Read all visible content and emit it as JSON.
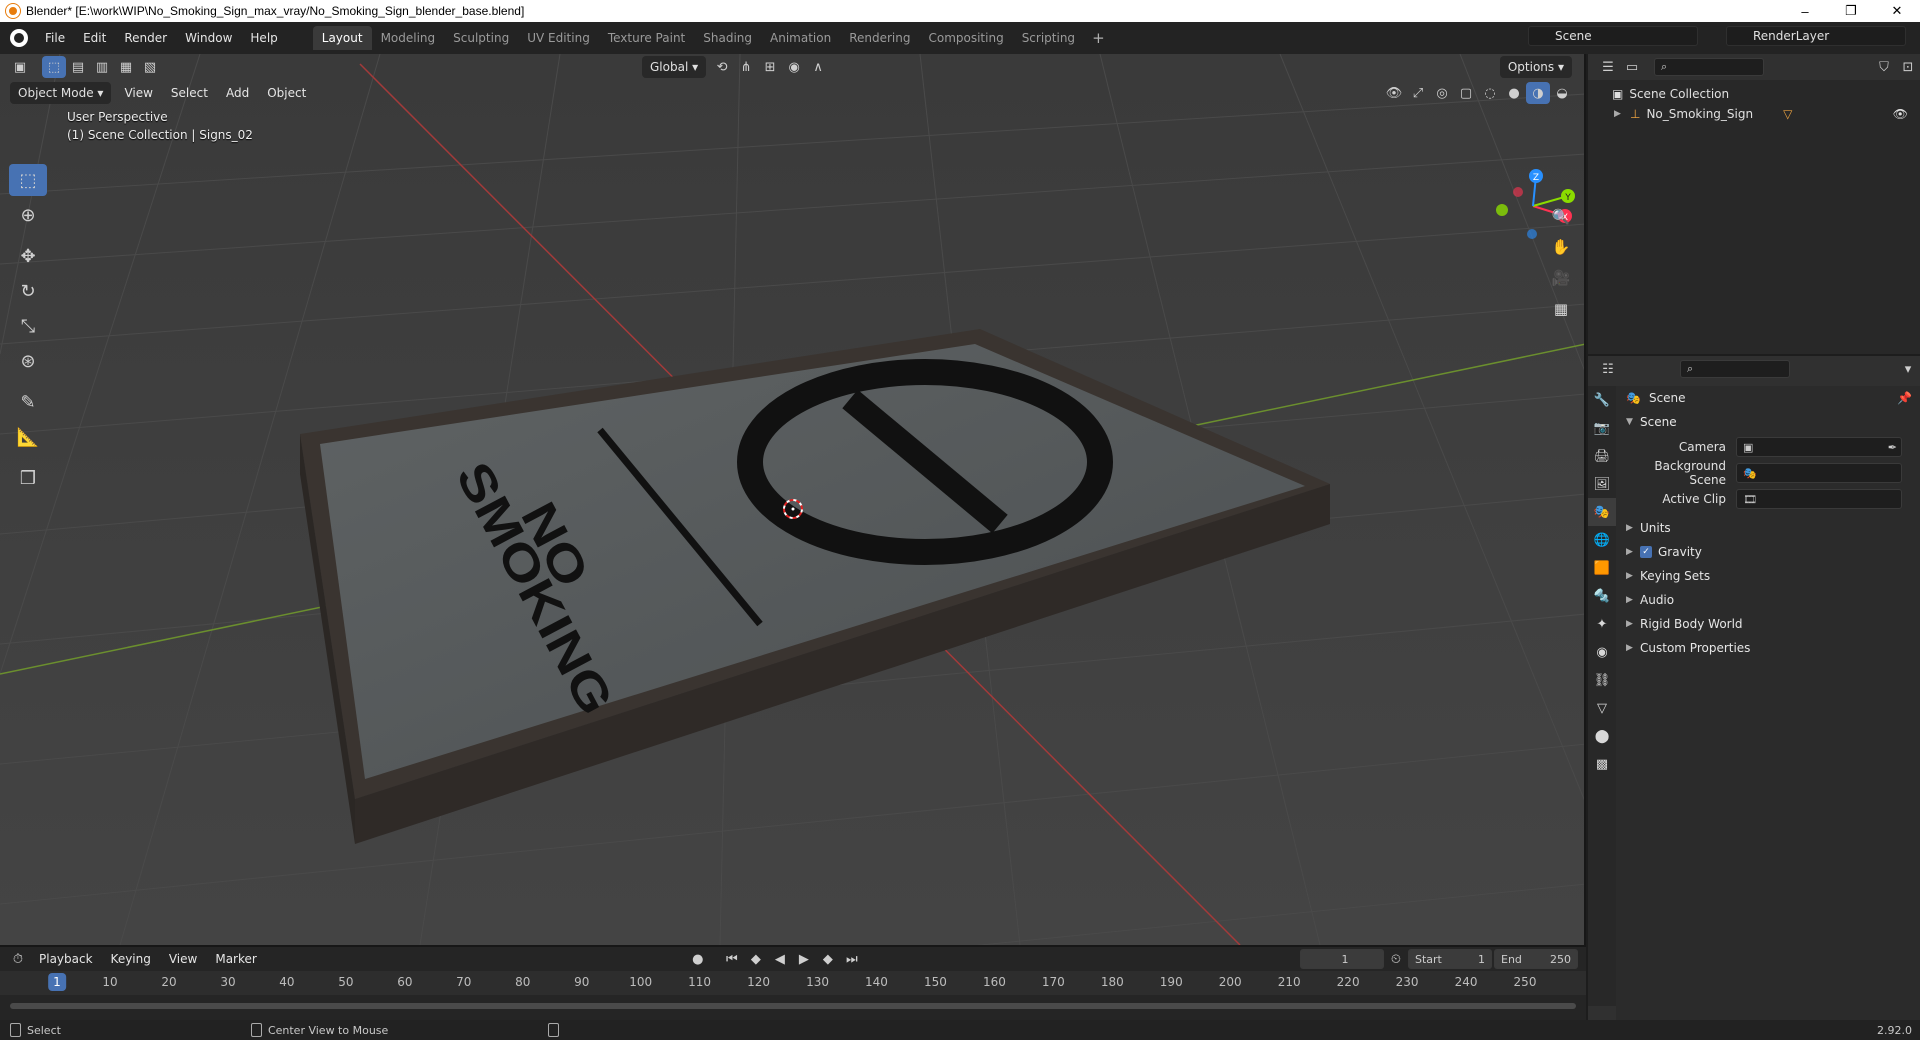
{
  "window": {
    "title": "Blender* [E:\\work\\WIP\\No_Smoking_Sign_max_vray/No_Smoking_Sign_blender_base.blend]",
    "minimize": "–",
    "maximize": "❐",
    "close": "✕"
  },
  "topbar": {
    "menus": [
      "File",
      "Edit",
      "Render",
      "Window",
      "Help"
    ],
    "workspaces": [
      "Layout",
      "Modeling",
      "Sculpting",
      "UV Editing",
      "Texture Paint",
      "Shading",
      "Animation",
      "Rendering",
      "Compositing",
      "Scripting"
    ],
    "active_workspace": "Layout",
    "scene": "Scene",
    "view_layer": "RenderLayer"
  },
  "viewport": {
    "mode": "Object Mode",
    "menus": [
      "View",
      "Select",
      "Add",
      "Object"
    ],
    "transform_orientation": "Global",
    "options_label": "Options",
    "info_line1": "User Perspective",
    "info_line2": "(1) Scene Collection | Signs_02",
    "sign_text_line1": "NO",
    "sign_text_line2": "SMOKING",
    "gizmo_axes": [
      "X",
      "Y",
      "Z"
    ],
    "colors": {
      "x_axis": "#ff3352",
      "y_axis": "#8bdc00",
      "z_axis": "#2890ff",
      "background": "#3d3d3d"
    }
  },
  "outliner": {
    "root": "Scene Collection",
    "items": [
      {
        "name": "No_Smoking_Sign"
      }
    ]
  },
  "properties": {
    "header_title": "Scene",
    "section": "Scene",
    "fields": [
      {
        "label": "Camera",
        "value": ""
      },
      {
        "label": "Background Scene",
        "value": ""
      },
      {
        "label": "Active Clip",
        "value": ""
      }
    ],
    "panels": [
      "Units",
      "Gravity",
      "Keying Sets",
      "Audio",
      "Rigid Body World",
      "Custom Properties"
    ],
    "gravity_checked": true
  },
  "timeline": {
    "menus": [
      "Playback",
      "Keying",
      "View",
      "Marker"
    ],
    "current_frame": "1",
    "start_label": "Start",
    "start": "1",
    "end_label": "End",
    "end": "250",
    "ruler": [
      "1",
      "10",
      "20",
      "30",
      "40",
      "50",
      "60",
      "70",
      "80",
      "90",
      "100",
      "110",
      "120",
      "130",
      "140",
      "150",
      "160",
      "170",
      "180",
      "190",
      "200",
      "210",
      "220",
      "230",
      "240",
      "250"
    ]
  },
  "statusbar": {
    "left": "Select",
    "middle": "Center View to Mouse",
    "version": "2.92.0"
  }
}
